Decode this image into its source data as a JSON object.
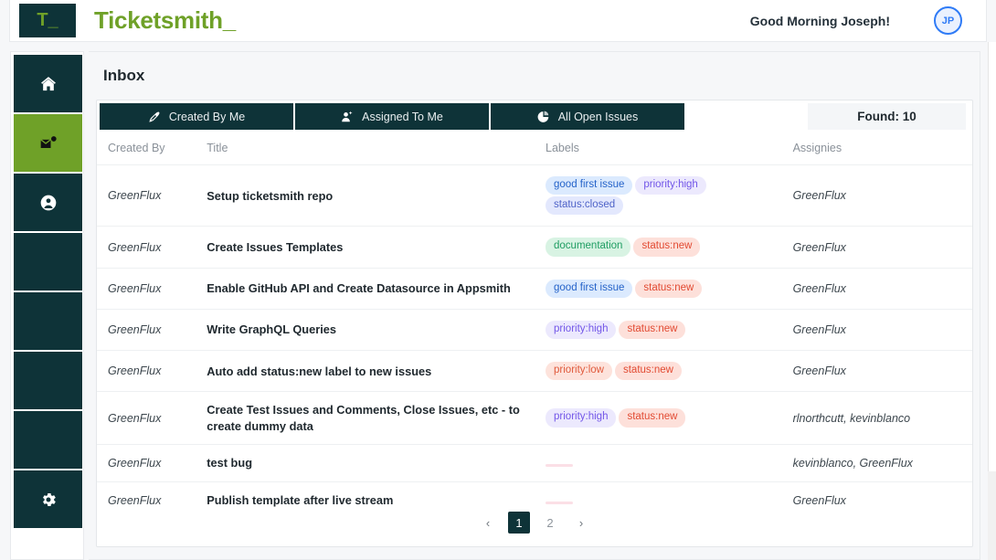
{
  "header": {
    "logo_mark": "T_",
    "brand": "Ticketsmith_",
    "greeting": "Good Morning Joseph!",
    "avatar_initials": "JP"
  },
  "sidebar": {
    "items": [
      {
        "name": "home",
        "icon": "home-icon",
        "active": false
      },
      {
        "name": "inbox",
        "icon": "inbox-icon",
        "active": true
      },
      {
        "name": "profile",
        "icon": "user-icon",
        "active": false
      },
      {
        "name": "blank-1",
        "icon": "",
        "active": false
      },
      {
        "name": "blank-2",
        "icon": "",
        "active": false
      },
      {
        "name": "blank-3",
        "icon": "",
        "active": false
      },
      {
        "name": "blank-4",
        "icon": "",
        "active": false
      },
      {
        "name": "settings",
        "icon": "gear-icon",
        "active": false
      }
    ]
  },
  "main": {
    "page_title": "Inbox",
    "tabs": [
      {
        "label": "Created By Me",
        "icon": "pen-nib-icon"
      },
      {
        "label": "Assigned To Me",
        "icon": "user-plus-icon"
      },
      {
        "label": "All Open Issues",
        "icon": "pie-chart-icon"
      }
    ],
    "found_label": "Found: 10",
    "table": {
      "columns": [
        "Created By",
        "Title",
        "Labels",
        "Assignies"
      ],
      "rows": [
        {
          "created_by": "GreenFlux",
          "title": "Setup ticketsmith repo",
          "labels": [
            {
              "text": "good first issue",
              "color": "chip-blue"
            },
            {
              "text": "priority:high",
              "color": "chip-purple"
            },
            {
              "text": "status:closed",
              "color": "chip-peri"
            }
          ],
          "assignies": "GreenFlux"
        },
        {
          "created_by": "GreenFlux",
          "title": "Create Issues Templates",
          "labels": [
            {
              "text": "documentation",
              "color": "chip-green"
            },
            {
              "text": "status:new",
              "color": "chip-red"
            }
          ],
          "assignies": "GreenFlux"
        },
        {
          "created_by": "GreenFlux",
          "title": "Enable GitHub API and Create Datasource in Appsmith",
          "labels": [
            {
              "text": "good first issue",
              "color": "chip-blue"
            },
            {
              "text": "status:new",
              "color": "chip-red"
            }
          ],
          "assignies": "GreenFlux"
        },
        {
          "created_by": "GreenFlux",
          "title": "Write GraphQL Queries",
          "labels": [
            {
              "text": "priority:high",
              "color": "chip-purple"
            },
            {
              "text": "status:new",
              "color": "chip-red"
            }
          ],
          "assignies": "GreenFlux"
        },
        {
          "created_by": "GreenFlux",
          "title": "Auto add status:new label to new issues",
          "labels": [
            {
              "text": "priority:low",
              "color": "chip-salmon"
            },
            {
              "text": "status:new",
              "color": "chip-red"
            }
          ],
          "assignies": "GreenFlux"
        },
        {
          "created_by": "GreenFlux",
          "title": "Create Test Issues and Comments, Close Issues, etc - to create dummy data",
          "labels": [
            {
              "text": "priority:high",
              "color": "chip-purple"
            },
            {
              "text": "status:new",
              "color": "chip-red"
            }
          ],
          "assignies": "rlnorthcutt, kevinblanco"
        },
        {
          "created_by": "GreenFlux",
          "title": "test bug",
          "labels": [],
          "assignies": "kevinblanco, GreenFlux"
        },
        {
          "created_by": "GreenFlux",
          "title": "Publish template after live stream",
          "labels": [],
          "assignies": "GreenFlux"
        }
      ]
    },
    "pagination": {
      "prev": "‹",
      "next": "›",
      "pages": [
        "1",
        "2"
      ],
      "current": "1"
    }
  },
  "colors": {
    "brand_green": "#6fa128",
    "dark_teal": "#0e3338",
    "avatar_blue": "#2f7bf6",
    "page_bg": "#f6f7f9"
  }
}
